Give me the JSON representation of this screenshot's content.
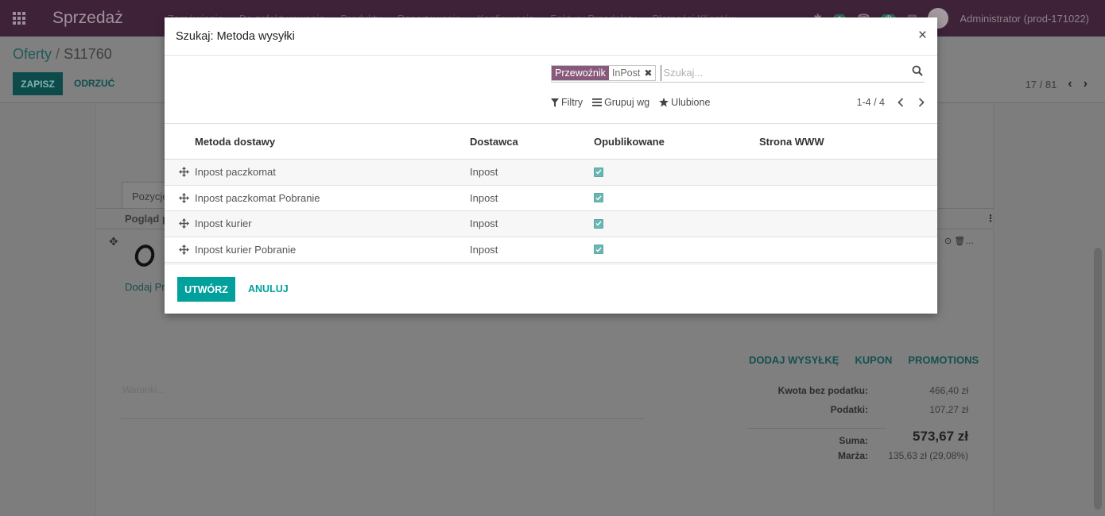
{
  "app": {
    "title": "Sprzedaż",
    "menu": [
      "Zamówienia",
      "Do zafakturowania",
      "Produkty",
      "Raportowanie",
      "Konfiguracja",
      "Faktury Przedpłaty",
      "Płatności Klientów"
    ],
    "user": "Administrator (prod-171022)"
  },
  "breadcrumb": {
    "parent": "Oferty",
    "separator": "/",
    "current": "S11760"
  },
  "toolbar": {
    "save_label": "ZAPISZ",
    "discard_label": "ODRZUĆ",
    "pager": "17 / 81"
  },
  "form": {
    "tab_label": "Pozycje",
    "lines_header": "Pogląd p",
    "add_product_label": "Dodaj Pr",
    "actions": [
      "DODAJ WYSYŁKĘ",
      "KUPON",
      "PROMOTIONS"
    ],
    "terms_placeholder": "Warunki...",
    "totals": {
      "untaxed_label": "Kwota bez podatku:",
      "untaxed_value": "466,40 zł",
      "taxes_label": "Podatki:",
      "taxes_value": "107,27 zł",
      "total_label": "Suma:",
      "total_value": "573,67 zł",
      "margin_label": "Marża:",
      "margin_value": "135,63 zł (29,08%)"
    }
  },
  "modal": {
    "title": "Szukaj: Metoda wysyłki",
    "close_glyph": "×",
    "search": {
      "facet_label": "Przewoźnik",
      "facet_value": "InPost",
      "placeholder": "Szukaj..."
    },
    "filters": {
      "filters_label": "Filtry",
      "groupby_label": "Grupuj wg",
      "favorites_label": "Ulubione"
    },
    "pager": "1-4 / 4",
    "columns": {
      "name": "Metoda dostawy",
      "provider": "Dostawca",
      "published": "Opublikowane",
      "website": "Strona WWW"
    },
    "rows": [
      {
        "name": "Inpost paczkomat",
        "provider": "Inpost",
        "published": true
      },
      {
        "name": "Inpost paczkomat Pobranie",
        "provider": "Inpost",
        "published": true
      },
      {
        "name": "Inpost kurier",
        "provider": "Inpost",
        "published": true
      },
      {
        "name": "Inpost kurier Pobranie",
        "provider": "Inpost",
        "published": true
      }
    ],
    "create_label": "UTWÓRZ",
    "cancel_label": "ANULUJ"
  },
  "colors": {
    "accent": "#00a09d",
    "facet": "#875a7b",
    "navbar": "#3e2238"
  }
}
